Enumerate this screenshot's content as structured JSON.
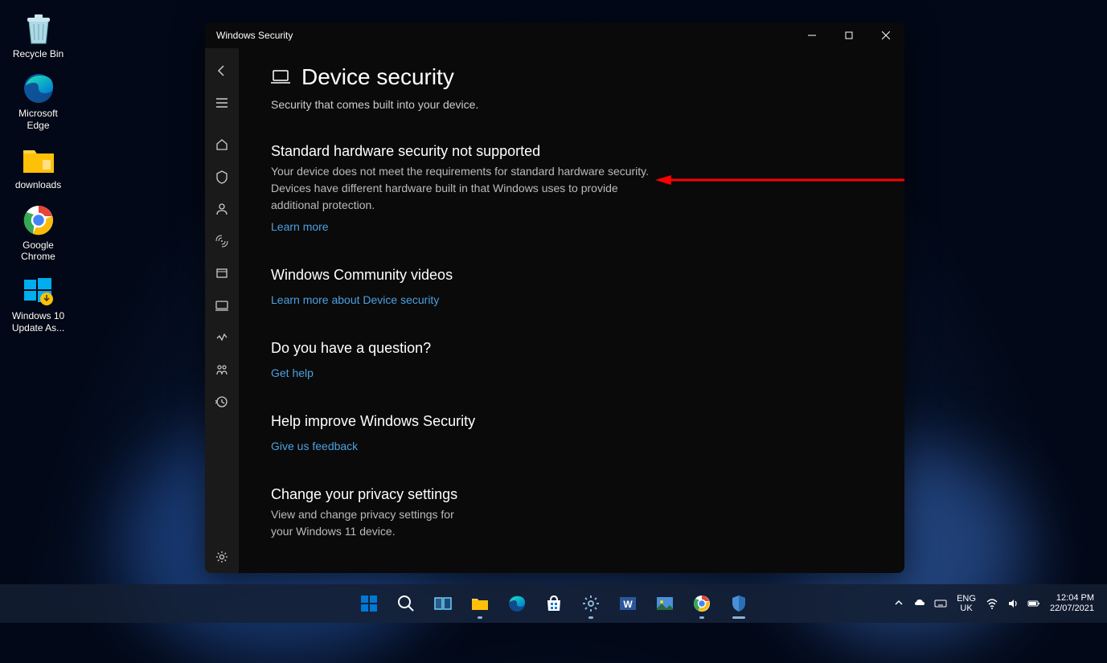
{
  "desktop": {
    "icons": [
      {
        "name": "recycle-bin",
        "label": "Recycle Bin"
      },
      {
        "name": "edge",
        "label": "Microsoft Edge"
      },
      {
        "name": "downloads-folder",
        "label": "downloads"
      },
      {
        "name": "chrome",
        "label": "Google Chrome"
      },
      {
        "name": "win-update",
        "label": "Windows 10 Update As..."
      }
    ]
  },
  "window": {
    "title": "Windows Security",
    "page": {
      "title": "Device security",
      "subtitle": "Security that comes built into your device."
    },
    "sections": {
      "hardware": {
        "title": "Standard hardware security not supported",
        "body": "Your device does not meet the requirements for standard hardware security. Devices have different hardware built in that Windows uses to provide additional protection.",
        "link": "Learn more"
      },
      "videos": {
        "title": "Windows Community videos",
        "link": "Learn more about Device security"
      },
      "question": {
        "title": "Do you have a question?",
        "link": "Get help"
      },
      "feedback": {
        "title": "Help improve Windows Security",
        "link": "Give us feedback"
      },
      "privacy": {
        "title": "Change your privacy settings",
        "body": "View and change privacy settings for your Windows 11 device."
      }
    }
  },
  "taskbar": {
    "lang_top": "ENG",
    "lang_bottom": "UK",
    "time": "12:04 PM",
    "date": "22/07/2021"
  }
}
